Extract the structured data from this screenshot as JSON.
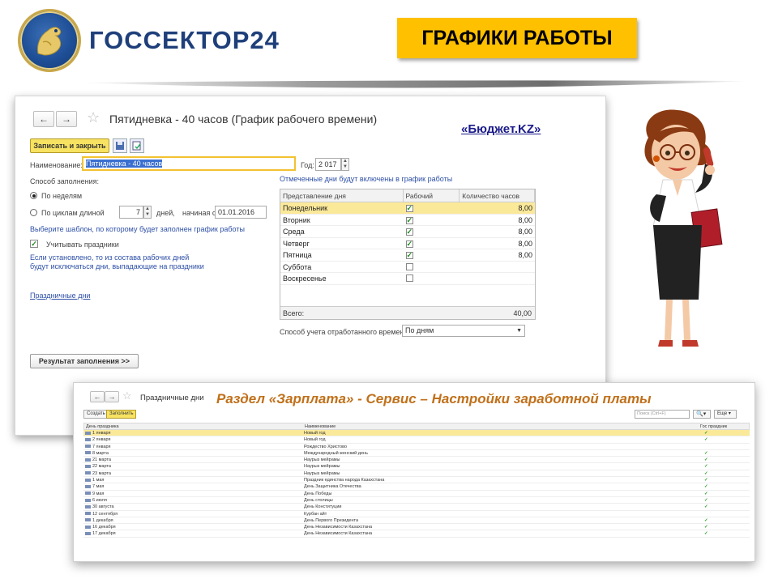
{
  "logo": {
    "text": "ГОССЕКТОР24"
  },
  "title_badge": "ГРАФИКИ РАБОТЫ",
  "budget_link": "«Бюджет.KZ»",
  "main_window": {
    "nav_back": "←",
    "nav_forward": "→",
    "star": "☆",
    "title": "Пятидневка - 40 часов (График рабочего времени)",
    "save_close": "Записать и закрыть",
    "name_label": "Наименование:",
    "name_value": "Пятидневка - 40 часов",
    "year_label": "Год:",
    "year_value": "2 017",
    "fill_method_label": "Способ заполнения:",
    "radio_weeks": "По неделям",
    "radio_cycles": "По циклам длиной",
    "cycle_value": "7",
    "days_label": "дней,",
    "start_label": "начиная с:",
    "start_value": "01.01.2016",
    "template_hint": "Выберите шаблон, по которому будет заполнен график работы",
    "holidays_check": "Учитывать праздники",
    "holidays_hint_1": "Если установлено, то из состава рабочих дней",
    "holidays_hint_2": "будут исключаться дни, выпадающие на праздники",
    "holidays_link": "Праздничные дни",
    "result_button": "Результат заполнения >>",
    "marked_days_hint": "Отмеченные дни будут включены в график работы",
    "table_headers": [
      "Представление дня",
      "Рабочий",
      "Количество часов"
    ],
    "days": [
      {
        "day": "Понедельник",
        "working": true,
        "hours": "8,00"
      },
      {
        "day": "Вторник",
        "working": true,
        "hours": "8,00"
      },
      {
        "day": "Среда",
        "working": true,
        "hours": "8,00"
      },
      {
        "day": "Четверг",
        "working": true,
        "hours": "8,00"
      },
      {
        "day": "Пятница",
        "working": true,
        "hours": "8,00"
      },
      {
        "day": "Суббота",
        "working": false,
        "hours": ""
      },
      {
        "day": "Воскресенье",
        "working": false,
        "hours": ""
      }
    ],
    "total_label": "Всего:",
    "total_value": "40,00",
    "accounting_label": "Способ учета отработанного времени:",
    "accounting_value": "По дням"
  },
  "holidays_window": {
    "title": "Праздничные дни",
    "heading": "Раздел «Зарплата» - Сервис – Настройки заработной платы",
    "create_btn": "Создать",
    "fill_btn": "Заполнить",
    "search_placeholder": "Поиск (Ctrl+F)",
    "more_btn": "Еще",
    "headers": [
      "День праздника",
      "Наименование",
      "Гос праздник"
    ],
    "rows": [
      {
        "date": "1 января",
        "name": "Новый год",
        "state": true
      },
      {
        "date": "2 января",
        "name": "Новый год",
        "state": true
      },
      {
        "date": "7 января",
        "name": "Рождество Христово",
        "state": false
      },
      {
        "date": "8 марта",
        "name": "Международный женский день",
        "state": true
      },
      {
        "date": "21 марта",
        "name": "Наурыз мейрамы",
        "state": true
      },
      {
        "date": "22 марта",
        "name": "Наурыз мейрамы",
        "state": true
      },
      {
        "date": "23 марта",
        "name": "Наурыз мейрамы",
        "state": true
      },
      {
        "date": "1 мая",
        "name": "Праздник единства народа Казахстана",
        "state": true
      },
      {
        "date": "7 мая",
        "name": "День Защитника Отечества",
        "state": true
      },
      {
        "date": "9 мая",
        "name": "День Победы",
        "state": true
      },
      {
        "date": "6 июля",
        "name": "День столицы",
        "state": true
      },
      {
        "date": "30 августа",
        "name": "День Конституции",
        "state": true
      },
      {
        "date": "12 сентября",
        "name": "Курбан айт",
        "state": false
      },
      {
        "date": "1 декабря",
        "name": "День Первого Президента",
        "state": true
      },
      {
        "date": "16 декабря",
        "name": "День Независимости Казахстана",
        "state": true
      },
      {
        "date": "17 декабря",
        "name": "День Независимости Казахстана",
        "state": true
      }
    ]
  },
  "colors": {
    "accent_yellow": "#ffc000",
    "brand_blue": "#1e3f7a",
    "heading_orange": "#c0701a",
    "check_green": "#2a9d2a"
  }
}
